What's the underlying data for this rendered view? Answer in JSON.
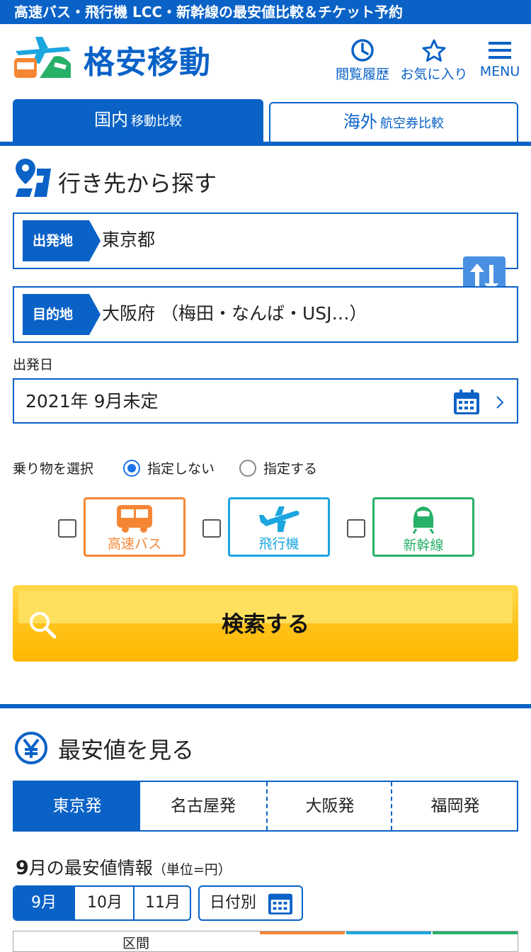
{
  "top_banner": "高速バス・飛行機 LCC・新幹線の最安値比較＆チケット予約",
  "header": {
    "site_name": "格安移動",
    "history_label": "閲覧履歴",
    "favorites_label": "お気に入り",
    "menu_label": "MENU"
  },
  "tabs": [
    {
      "main": "国内",
      "sub": "移動比較"
    },
    {
      "main": "海外",
      "sub": "航空券比較"
    }
  ],
  "destination_search": {
    "title": "行き先から探す",
    "origin_tag": "出発地",
    "origin_value": "東京都",
    "dest_tag": "目的地",
    "dest_value": "大阪府 （梅田・なんば・USJ…）",
    "date_label": "出発日",
    "date_value": "2021年 9月未定",
    "vehicle_label": "乗り物を選択",
    "radio_no_specify": "指定しない",
    "radio_specify": "指定する",
    "radio_selected": "指定しない",
    "modes": [
      {
        "label": "高速バス",
        "color": "#f58634"
      },
      {
        "label": "飛行機",
        "color": "#1ba6e0"
      },
      {
        "label": "新幹線",
        "color": "#27b068"
      }
    ],
    "search_button": "検索する"
  },
  "cheapest": {
    "title": "最安値を見る",
    "origin_tabs": [
      "東京発",
      "名古屋発",
      "大阪発",
      "福岡発"
    ],
    "month_heading_num": "9",
    "month_heading_text": "月の最安値情報",
    "unit": "（単位=円）",
    "months": [
      "9月",
      "10月",
      "11月"
    ],
    "by_date": "日付別",
    "table_header": "区間"
  },
  "colors": {
    "brand": "#0a62c7",
    "accent_yellow": "#ffc21a"
  }
}
